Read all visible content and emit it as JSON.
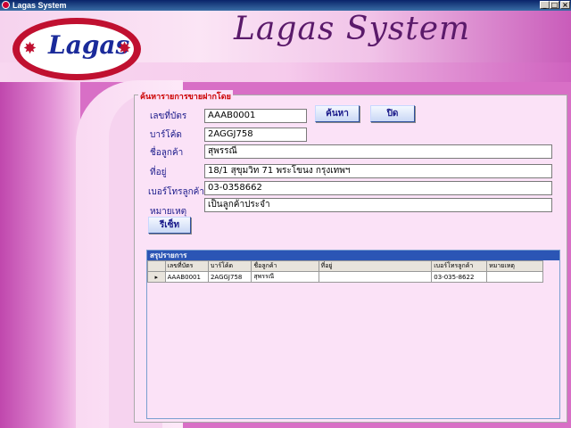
{
  "window": {
    "title": "Lagas System",
    "minimize": "_",
    "maximize": "□",
    "close": "×"
  },
  "header": {
    "title": "Lagas System",
    "logo_text": "Lagas"
  },
  "search_panel": {
    "legend": "ค้นหารายการขายฝากโดย",
    "card_no_label": "เลขที่บัตร",
    "card_no_value": "AAAB0001",
    "barcode_label": "บาร์โค้ด",
    "barcode_value": "2AGGJ758",
    "customer_name_label": "ชื่อลูกค้า",
    "customer_name_value": "สุพรรณี",
    "address_label": "ที่อยู่",
    "address_value": "18/1 สุขุมวิท 71 พระโขนง กรุงเทพฯ",
    "phone_label": "เบอร์โทรลูกค้า",
    "phone_value": "03-0358662",
    "note_label": "หมายเหตุ",
    "note_value": "เป็นลูกค้าประจำ",
    "search_button": "ค้นหา",
    "close_button": "ปิด",
    "reset_button": "รีเซ็ท"
  },
  "summary": {
    "title": "สรุปรายการ",
    "columns": [
      "เลขที่บัตร",
      "บาร์โค้ด",
      "ชื่อลูกค้า",
      "ที่อยู่",
      "เบอร์โทรลูกค้า",
      "หมายเหตุ"
    ],
    "row_indicator": "▸",
    "rows": [
      {
        "card_no": "AAAB0001",
        "barcode": "2AGGJ758",
        "name": "สุพรรณี",
        "address": "",
        "phone": "03-035-8622",
        "note": ""
      }
    ]
  },
  "colors": {
    "accent_red": "#c01030",
    "title_purple": "#5a1a6a",
    "grid_header_blue": "#2b55b5"
  }
}
